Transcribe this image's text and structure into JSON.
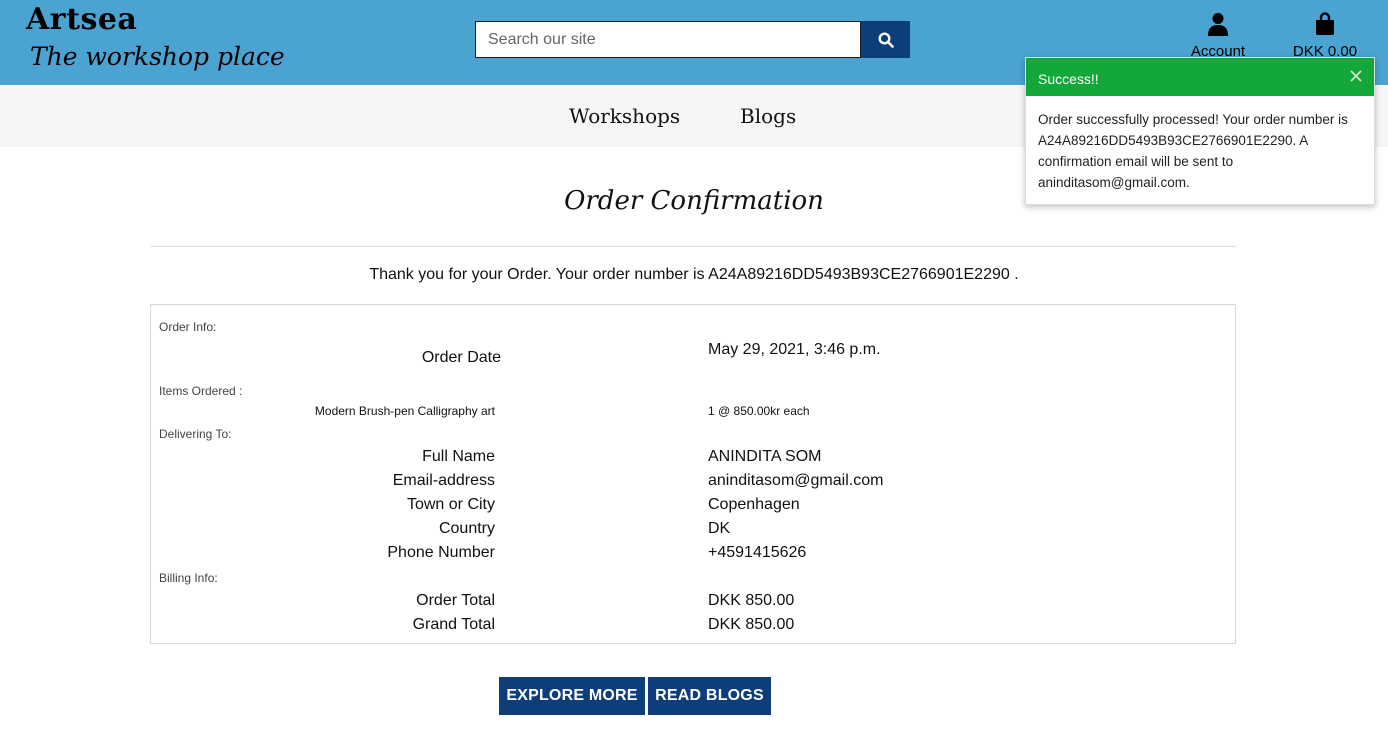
{
  "brand": {
    "name": "Artsea",
    "tagline": "The workshop place"
  },
  "header": {
    "search_placeholder": "Search our site",
    "search_icon": "search-icon",
    "account_label": "Account",
    "account_icon": "user-icon",
    "bag_label": "DKK 0.00",
    "bag_icon": "shopping-bag-icon"
  },
  "nav": {
    "items": [
      "Workshops",
      "Blogs"
    ]
  },
  "page": {
    "title": "Order Confirmation",
    "thanks": "Thank you for your Order. Your order number is A24A89216DD5493B93CE2766901E2290 ."
  },
  "order": {
    "order_info_heading": "Order Info:",
    "order_date_label": "Order Date",
    "order_date": "May 29, 2021, 3:46 p.m.",
    "items_heading": "Items Ordered :",
    "item_name": "Modern Brush-pen Calligraphy art",
    "item_qty": "1 @ 850.00kr each",
    "delivery_heading": "Delivering To:",
    "delivery": [
      {
        "label": "Full Name",
        "value": "ANINDITA SOM"
      },
      {
        "label": "Email-address",
        "value": "aninditasom@gmail.com"
      },
      {
        "label": "Town or City",
        "value": "Copenhagen"
      },
      {
        "label": "Country",
        "value": "DK"
      },
      {
        "label": "Phone Number",
        "value": "+4591415626"
      }
    ],
    "billing_heading": "Billing Info:",
    "billing": [
      {
        "label": "Order Total",
        "value": "DKK 850.00"
      },
      {
        "label": "Grand Total",
        "value": "DKK 850.00"
      }
    ]
  },
  "buttons": {
    "explore": "EXPLORE MORE",
    "blogs": "READ BLOGS"
  },
  "toast": {
    "title": "Success!!",
    "message": "Order successfully processed! Your order number is A24A89216DD5493B93CE2766901E2290. A confirmation email will be sent to aninditasom@gmail.com.",
    "close_icon": "close-icon"
  },
  "colors": {
    "header_bg": "#4aa3d1",
    "nav_bg": "#f5f6f7",
    "button_bg": "#0e3e7a",
    "toast_header": "#14a83a"
  }
}
